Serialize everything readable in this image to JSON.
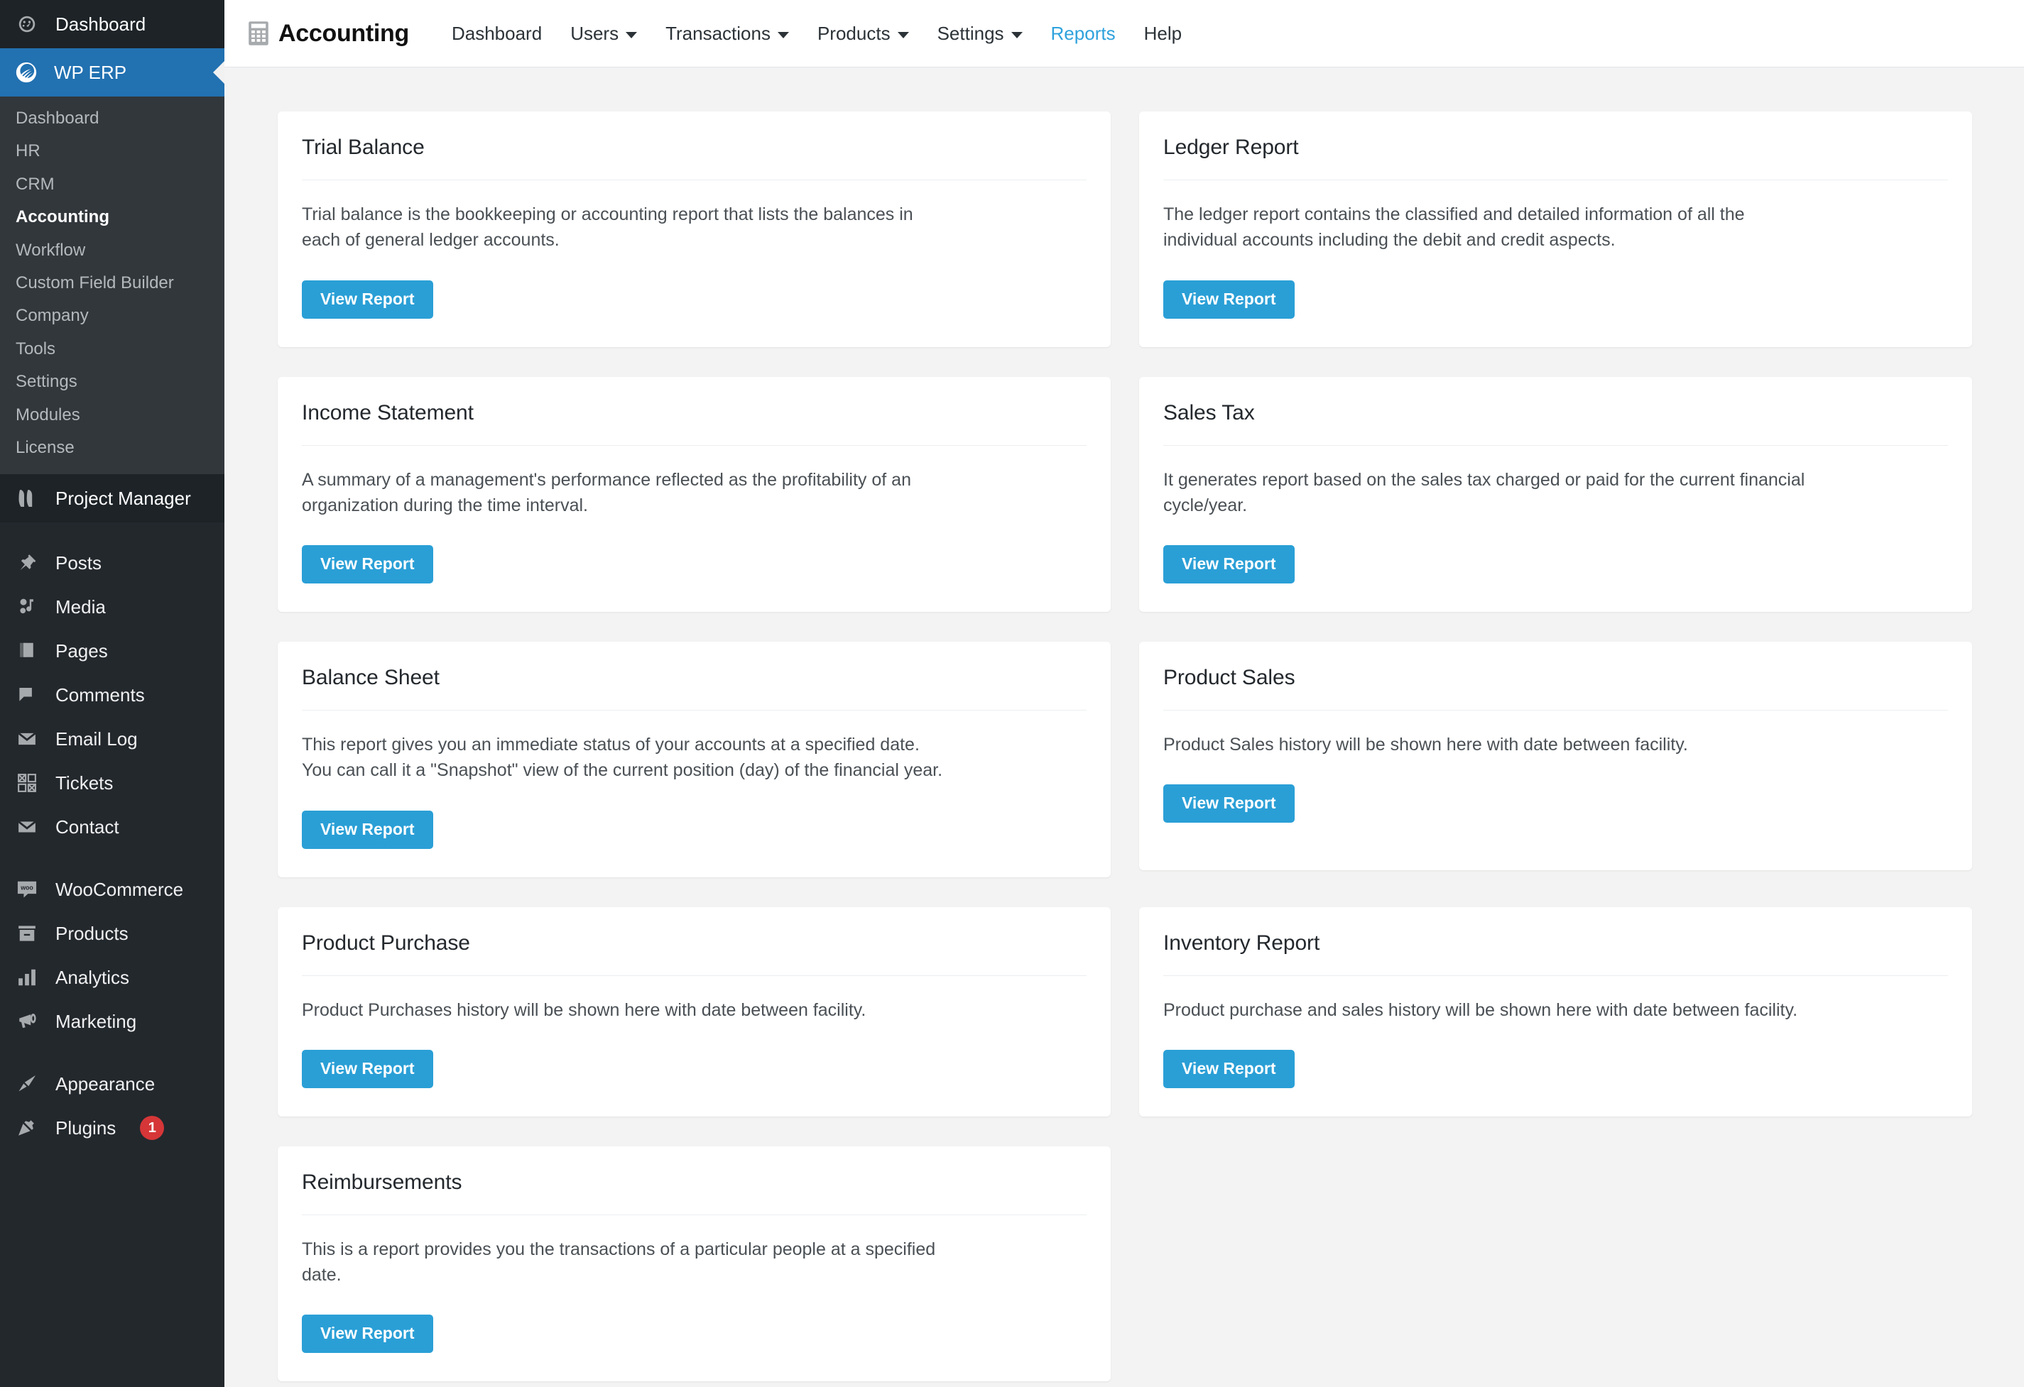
{
  "sidebar": {
    "dashboard": {
      "label": "Dashboard",
      "icon": "dashboard-icon"
    },
    "erp": {
      "label": "WP ERP",
      "icon": "wp-erp-logo-icon"
    },
    "erp_submenu": [
      {
        "label": "Dashboard",
        "active": false
      },
      {
        "label": "HR",
        "active": false
      },
      {
        "label": "CRM",
        "active": false
      },
      {
        "label": "Accounting",
        "active": true
      },
      {
        "label": "Workflow",
        "active": false
      },
      {
        "label": "Custom Field Builder",
        "active": false
      },
      {
        "label": "Company",
        "active": false
      },
      {
        "label": "Tools",
        "active": false
      },
      {
        "label": "Settings",
        "active": false
      },
      {
        "label": "Modules",
        "active": false
      },
      {
        "label": "License",
        "active": false
      }
    ],
    "project_manager": {
      "label": "Project Manager",
      "icon": "project-manager-icon"
    },
    "group_content": [
      {
        "label": "Posts",
        "icon": "pin-icon"
      },
      {
        "label": "Media",
        "icon": "media-icon"
      },
      {
        "label": "Pages",
        "icon": "pages-icon"
      },
      {
        "label": "Comments",
        "icon": "comment-icon"
      },
      {
        "label": "Email Log",
        "icon": "envelope-open-icon"
      },
      {
        "label": "Tickets",
        "icon": "tickets-grid-icon"
      },
      {
        "label": "Contact",
        "icon": "envelope-icon"
      }
    ],
    "group_commerce": [
      {
        "label": "WooCommerce",
        "icon": "woocommerce-icon"
      },
      {
        "label": "Products",
        "icon": "products-box-icon"
      },
      {
        "label": "Analytics",
        "icon": "bar-chart-icon"
      },
      {
        "label": "Marketing",
        "icon": "megaphone-icon"
      }
    ],
    "group_site": [
      {
        "label": "Appearance",
        "icon": "paintbrush-icon",
        "badge": ""
      },
      {
        "label": "Plugins",
        "icon": "plug-icon",
        "badge": "1"
      }
    ]
  },
  "topnav": {
    "brand_icon": "calculator-icon",
    "brand_title": "Accounting",
    "items": [
      {
        "label": "Dashboard",
        "has_caret": false,
        "active": false
      },
      {
        "label": "Users",
        "has_caret": true,
        "active": false
      },
      {
        "label": "Transactions",
        "has_caret": true,
        "active": false
      },
      {
        "label": "Products",
        "has_caret": true,
        "active": false
      },
      {
        "label": "Settings",
        "has_caret": true,
        "active": false
      },
      {
        "label": "Reports",
        "has_caret": false,
        "active": true
      },
      {
        "label": "Help",
        "has_caret": false,
        "active": false
      }
    ]
  },
  "colors": {
    "accent_blue": "#2a9fd6",
    "sidebar_bg": "#23282d",
    "sidebar_submenu_bg": "#32373c",
    "erp_highlight": "#2271b1",
    "badge_red": "#d63638",
    "link_blue": "#2ea2dc",
    "page_bg": "#f3f3f4"
  },
  "reports": [
    {
      "title": "Trial Balance",
      "desc_lines": [
        "Trial balance is the bookkeeping or accounting report that lists the balances in",
        "each of general ledger accounts."
      ],
      "button": "View Report"
    },
    {
      "title": "Ledger Report",
      "desc_lines": [
        "The ledger report contains the classified and detailed information of all the",
        "individual accounts including the debit and credit aspects."
      ],
      "button": "View Report"
    },
    {
      "title": "Income Statement",
      "desc_lines": [
        "A summary of a management's performance reflected as the profitability of an",
        "organization during the time interval."
      ],
      "button": "View Report"
    },
    {
      "title": "Sales Tax",
      "desc_lines": [
        "It generates report based on the sales tax charged or paid for the current financial",
        "cycle/year."
      ],
      "button": "View Report"
    },
    {
      "title": "Balance Sheet",
      "desc_lines": [
        "This report gives you an immediate status of your accounts at a specified date.",
        "You can call it a \"Snapshot\" view of the current position (day) of the financial year."
      ],
      "button": "View Report"
    },
    {
      "title": "Product Sales",
      "desc_lines": [
        "Product Sales history will be shown here with date between facility."
      ],
      "button": "View Report"
    },
    {
      "title": "Product Purchase",
      "desc_lines": [
        "Product Purchases history will be shown here with date between facility."
      ],
      "button": "View Report"
    },
    {
      "title": "Inventory Report",
      "desc_lines": [
        "Product purchase and sales history will be shown here with date between facility."
      ],
      "button": "View Report"
    },
    {
      "title": "Reimbursements",
      "desc_lines": [
        "This is a report provides you the transactions of a particular people at a specified",
        "date."
      ],
      "button": "View Report"
    }
  ]
}
